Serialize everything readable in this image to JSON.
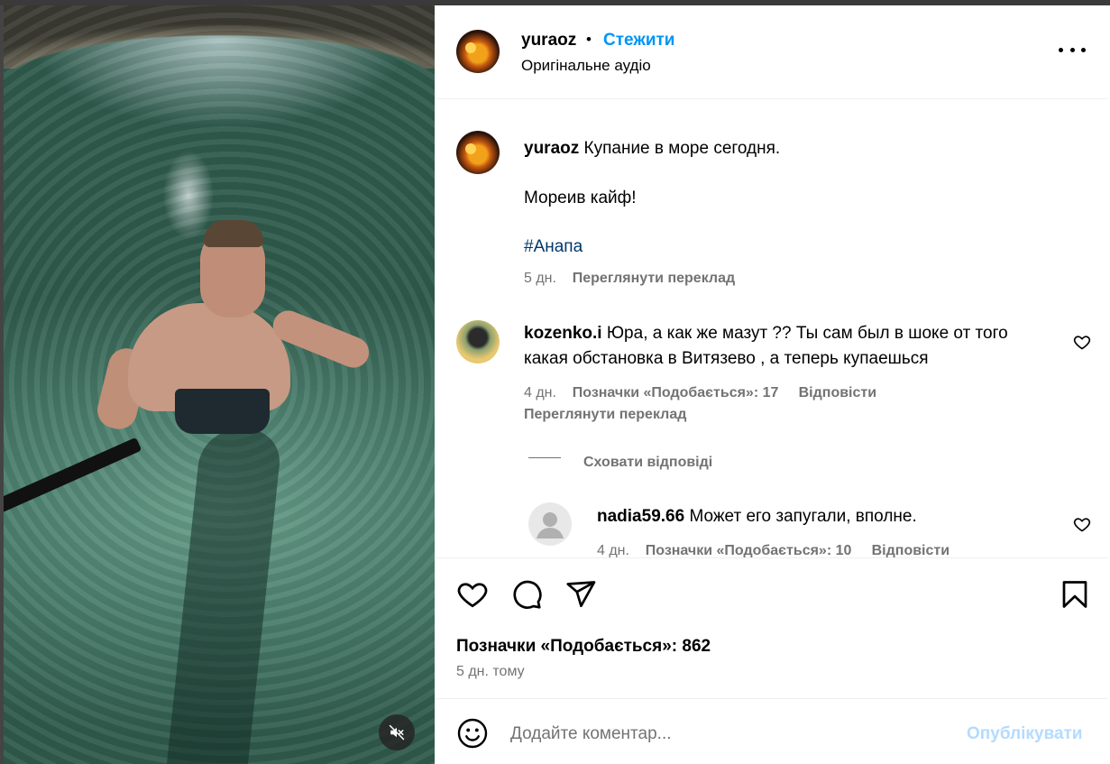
{
  "post": {
    "username": "yuraoz",
    "follow_label": "Стежити",
    "audio_label": "Оригінальне аудіо"
  },
  "caption": {
    "username": "yuraoz",
    "line1": "Купание в море сегодня.",
    "line2": "Мореив кайф!",
    "hashtag": "#Анапа",
    "time": "5 дн.",
    "translate": "Переглянути переклад"
  },
  "comments": [
    {
      "username": "kozenko.i",
      "text_line1": "Юра, а как же мазут ?? Ты сам был в шоке от того",
      "text_line2": "какая обстановка в Витязево , а теперь купаешься",
      "time": "4 дн.",
      "likes": "Позначки «Подобається»: 17",
      "reply": "Відповісти",
      "translate": "Переглянути переклад"
    }
  ],
  "hide_replies": "Сховати відповіді",
  "replies": [
    {
      "username": "nadia59.66",
      "text": "Может его запугали, вполне.",
      "time": "4 дн.",
      "likes": "Позначки «Подобається»: 10",
      "reply": "Відповісти"
    }
  ],
  "footer": {
    "likes_total": "Позначки «Подобається»: 862",
    "posted": "5 дн. тому"
  },
  "composer": {
    "placeholder": "Додайте коментар...",
    "publish": "Опублікувати"
  },
  "icons": {
    "mute": "speaker-muted-icon",
    "like": "heart-icon",
    "comment": "comment-bubble-icon",
    "share": "paper-plane-icon",
    "save": "bookmark-icon",
    "emoji": "emoji-smile-icon",
    "more": "more-dots-icon"
  },
  "colors": {
    "link_blue": "#0095f6",
    "hashtag": "#00376b",
    "muted_text": "#737373",
    "publish_disabled": "#b3dbff"
  }
}
